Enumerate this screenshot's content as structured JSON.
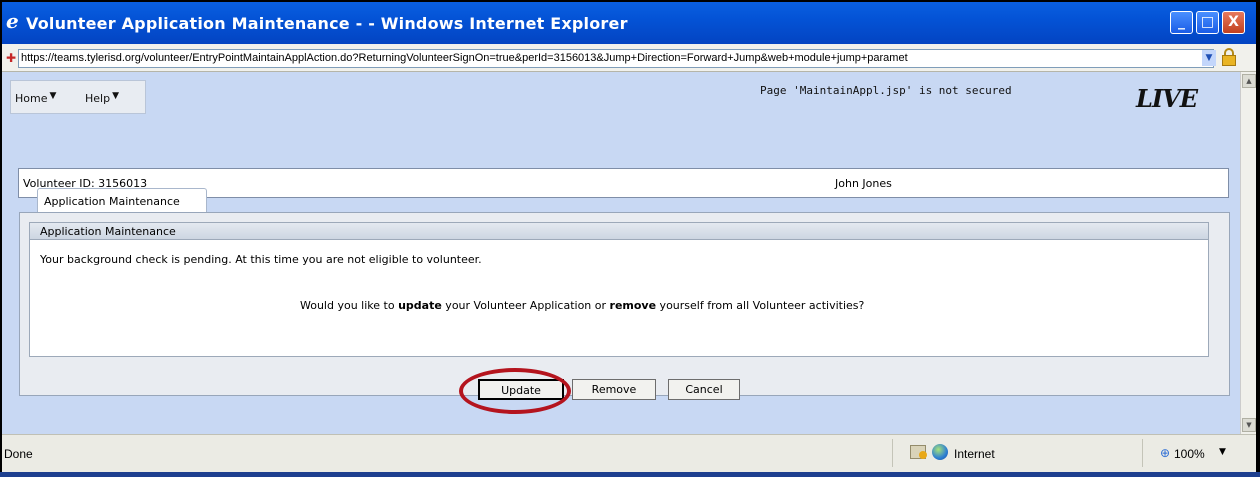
{
  "window": {
    "title": "Volunteer Application Maintenance - - Windows Internet Explorer",
    "minimize": "_",
    "maximize": "□",
    "close": "X"
  },
  "address": {
    "url": "https://teams.tylerisd.org/volunteer/EntryPointMaintainApplAction.do?ReturningVolunteerSignOn=true&perId=3156013&Jump+Direction=Forward+Jump&web+module+jump+paramet"
  },
  "nav": {
    "home": "Home",
    "help": "Help",
    "secure_note": "Page 'MaintainAppl.jsp' is not secured",
    "logo": "LIVE"
  },
  "volunteer": {
    "id_label": "Volunteer ID: 3156013",
    "name": "John Jones"
  },
  "tab": {
    "label": "Application Maintenance"
  },
  "section": {
    "heading": "Application Maintenance",
    "message": "Your background check is pending. At this time you are not eligible to volunteer.",
    "question_pre": "Would you like to ",
    "question_update": "update",
    "question_mid": " your Volunteer Application or ",
    "question_remove": "remove",
    "question_post": " yourself from all Volunteer activities?"
  },
  "buttons": {
    "update": "Update",
    "remove": "Remove",
    "cancel": "Cancel"
  },
  "status": {
    "text": "Done",
    "zone": "Internet",
    "zoom": "100%"
  }
}
